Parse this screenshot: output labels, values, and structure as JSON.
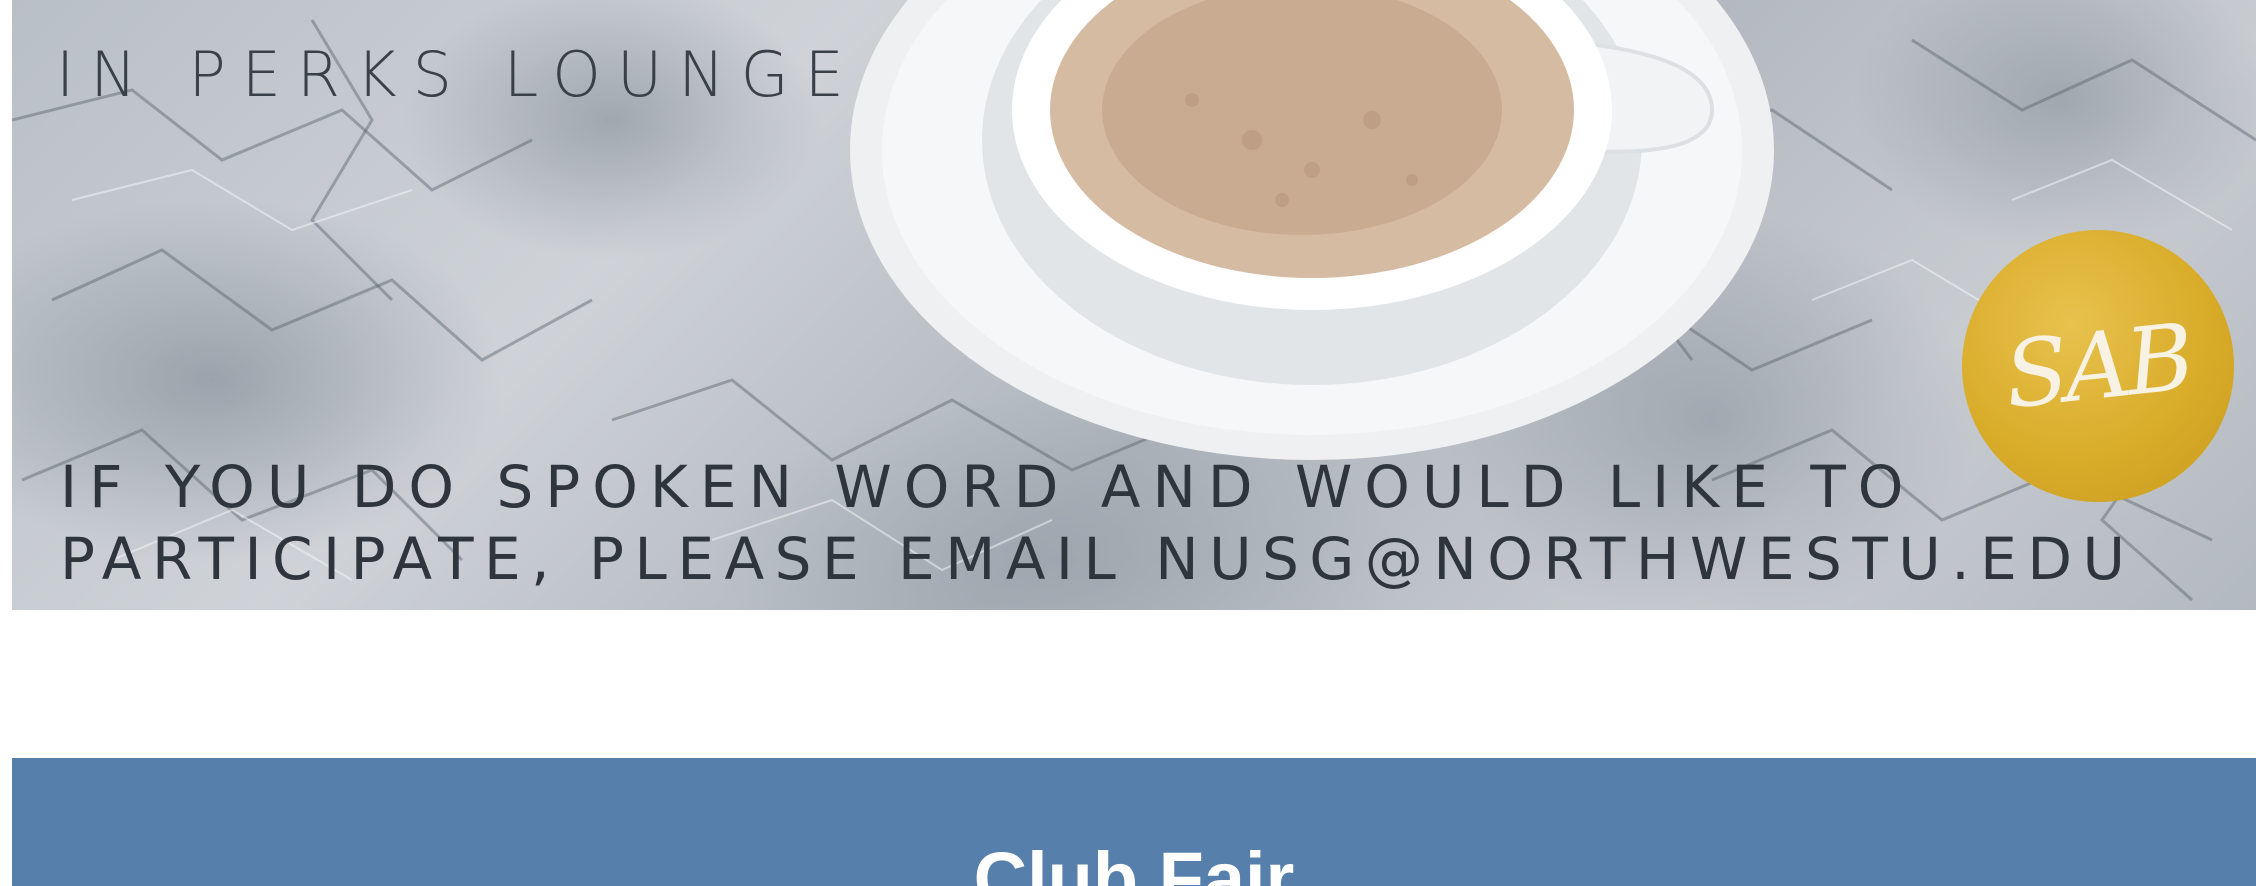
{
  "banner": {
    "headline_top": "IN PERKS LOUNGE",
    "info_line_1": "IF YOU DO SPOKEN WORD AND WOULD LIKE TO",
    "info_line_2": "PARTICIPATE, PLEASE EMAIL NUSG@NORTHWESTU.EDU",
    "badge_text": "SAB",
    "colors": {
      "badge": "#d9ac2a",
      "text": "#2f353c"
    }
  },
  "section": {
    "title": "Club Fair",
    "color": "#5680ab"
  }
}
